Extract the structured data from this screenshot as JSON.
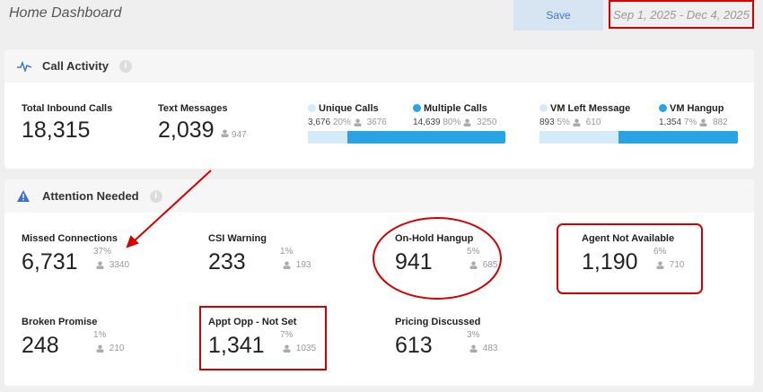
{
  "header": {
    "title": "Home Dashboard",
    "save_label": "Save",
    "date_range": "Sep 1, 2025 - Dec 4, 2025"
  },
  "call_activity": {
    "title": "Call Activity",
    "info": "i",
    "total_inbound": {
      "label": "Total Inbound Calls",
      "value": "18,315"
    },
    "text_messages": {
      "label": "Text Messages",
      "value": "2,039",
      "contacts": "947"
    },
    "calls_split": {
      "a": {
        "label": "Unique Calls",
        "value": "3,676",
        "pct": "20%",
        "contacts": "3676"
      },
      "b": {
        "label": "Multiple Calls",
        "value": "14,639",
        "pct": "80%",
        "contacts": "3250"
      },
      "fraction_a": 0.2
    },
    "vm_split": {
      "a": {
        "label": "VM Left Message",
        "value": "893",
        "pct": "5%",
        "contacts": "610"
      },
      "b": {
        "label": "VM Hangup",
        "value": "1,354",
        "pct": "7%",
        "contacts": "882"
      },
      "fraction_a": 0.397
    }
  },
  "attention": {
    "title": "Attention Needed",
    "info": "i",
    "items": [
      {
        "label": "Missed Connections",
        "value": "6,731",
        "pct": "37%",
        "contacts": "3340"
      },
      {
        "label": "CSI Warning",
        "value": "233",
        "pct": "1%",
        "contacts": "193"
      },
      {
        "label": "On-Hold Hangup",
        "value": "941",
        "pct": "5%",
        "contacts": "685"
      },
      {
        "label": "Agent Not Available",
        "value": "1,190",
        "pct": "6%",
        "contacts": "710"
      },
      {
        "label": "Broken Promise",
        "value": "248",
        "pct": "1%",
        "contacts": "210"
      },
      {
        "label": "Appt Opp - Not Set",
        "value": "1,341",
        "pct": "7%",
        "contacts": "1035"
      },
      {
        "label": "Pricing Discussed",
        "value": "613",
        "pct": "3%",
        "contacts": "483"
      }
    ]
  },
  "colors": {
    "accent": "#29a3e3",
    "light": "#d4ecf8",
    "annotation": "#d40000"
  }
}
